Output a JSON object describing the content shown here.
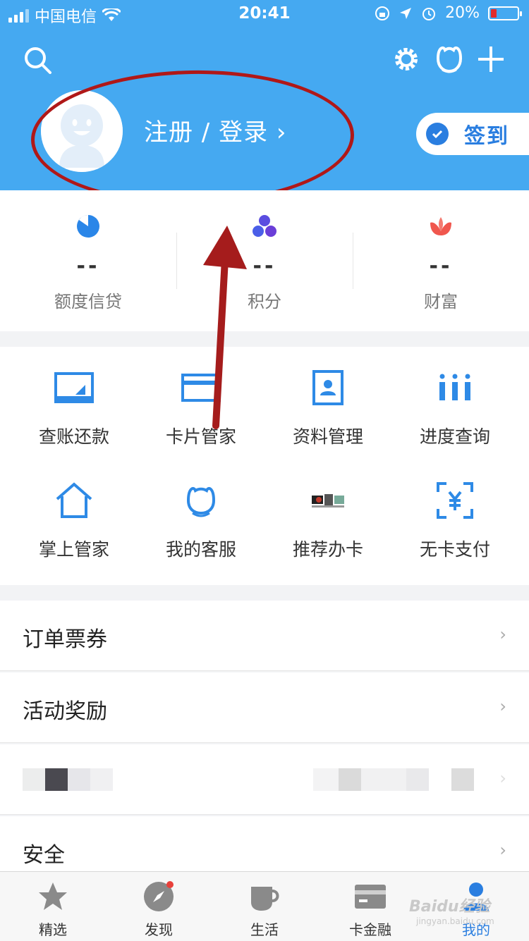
{
  "status_bar": {
    "carrier": "中国电信",
    "time": "20:41",
    "battery": "20%"
  },
  "header": {
    "login_text": "注册 / 登录 ›",
    "signin_label": "签到",
    "icons": [
      "search-icon",
      "settings-gear-icon",
      "customer-service-icon",
      "add-plus-icon"
    ],
    "accent_color": "#45a9f1"
  },
  "stats": [
    {
      "value": "--",
      "label": "额度信贷",
      "icon": "pie-icon",
      "color": "#2a86e8"
    },
    {
      "value": "--",
      "label": "积分",
      "icon": "dots-icon",
      "color": "#5a4de0"
    },
    {
      "value": "--",
      "label": "财富",
      "icon": "lotus-icon",
      "color": "#f0574e"
    }
  ],
  "grid": [
    {
      "label": "查账还款",
      "icon": "bill-icon"
    },
    {
      "label": "卡片管家",
      "icon": "card-icon"
    },
    {
      "label": "资料管理",
      "icon": "profile-icon"
    },
    {
      "label": "进度查询",
      "icon": "progress-icon"
    },
    {
      "label": "掌上管家",
      "icon": "home-icon"
    },
    {
      "label": "我的客服",
      "icon": "service-icon"
    },
    {
      "label": "推荐办卡",
      "icon": "recommend-card-icon"
    },
    {
      "label": "无卡支付",
      "icon": "scan-yuan-icon"
    }
  ],
  "list": [
    {
      "label": "订单票券"
    },
    {
      "label": "活动奖励"
    },
    {
      "label": ""
    },
    {
      "label": "安全"
    }
  ],
  "chevron": "›",
  "tabs": [
    {
      "label": "精选",
      "icon": "star-icon"
    },
    {
      "label": "发现",
      "icon": "compass-icon"
    },
    {
      "label": "生活",
      "icon": "cup-icon"
    },
    {
      "label": "卡金融",
      "icon": "card-finance-icon"
    },
    {
      "label": "我的",
      "icon": "user-icon",
      "active": true
    }
  ],
  "watermark": {
    "main": "Baidu经验",
    "sub": "jingyan.baidu.com"
  }
}
